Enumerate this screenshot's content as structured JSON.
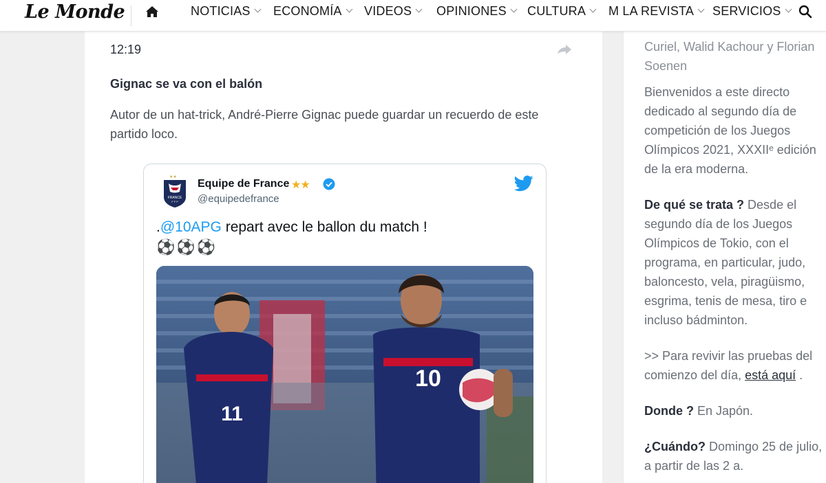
{
  "nav": {
    "logo": "Le Monde",
    "items": [
      {
        "label": "NOTICIAS"
      },
      {
        "label": "ECONOMÍA"
      },
      {
        "label": "VIDEOS"
      },
      {
        "label": "OPINIONES"
      },
      {
        "label": "CULTURA"
      },
      {
        "label": "M LA REVISTA"
      },
      {
        "label": "SERVICIOS"
      }
    ],
    "icons": [
      "home-icon",
      "search-icon",
      "chevron-down-icon"
    ]
  },
  "post": {
    "time": "12:19",
    "headline": "Gignac se va con el balón",
    "body": "Autor de un hat-trick, André-Pierre Gignac puede guardar un recuerdo de este partido loco."
  },
  "tweet": {
    "name": "Equipe de France",
    "stars": "★★",
    "handle": "@equipedefrance",
    "text_prefix": ".",
    "mention": "@10APG",
    "text_suffix": " repart avec le ballon du match !",
    "emojis": "⚽⚽⚽",
    "avatar_label": "FRANCE",
    "photo_numbers": [
      "11",
      "10"
    ],
    "colors": {
      "mention": "#1d9bf0",
      "verified": "#1d9bf0",
      "stars": "#f2b01e"
    }
  },
  "sidebar": {
    "authors": "Curiel, Walid Kachour y Florian Soenen",
    "intro": "Bienvenidos a este directo dedicado al segundo día de competición de los Juegos Olímpicos 2021, XXXIIᵉ edición de la era moderna.",
    "what_label": "De qué se trata ?",
    "what_text": " Desde el segundo día de los Juegos Olímpicos de Tokio, con el programa, en particular, judo, baloncesto, vela, piragüismo, esgrima, tenis de mesa, tiro e incluso bádminton.",
    "relive_prefix": ">> Para revivir las pruebas del comienzo del día, ",
    "relive_link": "está aquí",
    "relive_suffix": " .",
    "where_label": "Donde ?",
    "where_text": " En Japón.",
    "when_label": "¿Cuándo?",
    "when_text": " Domingo 25 de julio, a partir de las 2 a."
  }
}
